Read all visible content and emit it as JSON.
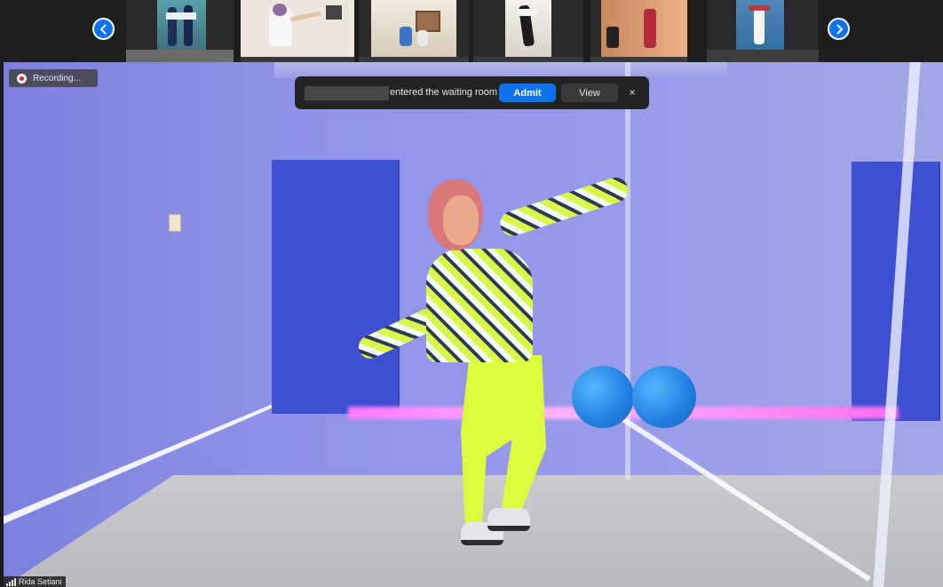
{
  "filmstrip": {
    "prev_icon": "chevron-left-icon",
    "next_icon": "chevron-right-icon",
    "accent": "#0e72ed",
    "tiles": [
      {
        "scene": "two-dancers"
      },
      {
        "scene": "dancer-hijab"
      },
      {
        "scene": "family-room"
      },
      {
        "scene": "dancer-doorway"
      },
      {
        "scene": "dancer-orange-room"
      },
      {
        "scene": "dancer-blue-wall"
      }
    ]
  },
  "recording": {
    "label": "Recording..."
  },
  "waiting_room_notice": {
    "message": "entered the waiting room",
    "admit_label": "Admit",
    "view_label": "View",
    "close_label": "×"
  },
  "speaker": {
    "name": "Rida Setiani"
  }
}
